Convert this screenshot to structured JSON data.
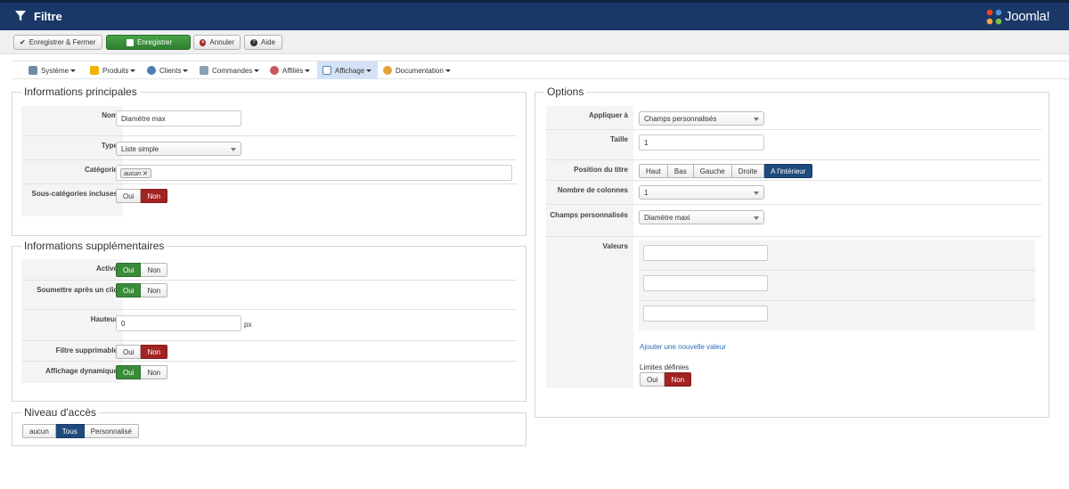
{
  "header": {
    "title": "Filtre",
    "logo_text": "Joomla!"
  },
  "toolbar": {
    "save_close": "Enregistrer & Fermer",
    "save": "Enregistrer",
    "cancel": "Annuler",
    "help": "Aide"
  },
  "menu": {
    "items": [
      {
        "label": "Système",
        "icon": "tools-icon"
      },
      {
        "label": "Produits",
        "icon": "box-icon"
      },
      {
        "label": "Clients",
        "icon": "users-icon"
      },
      {
        "label": "Commandes",
        "icon": "cart-icon"
      },
      {
        "label": "Affiliés",
        "icon": "affiliates-icon"
      },
      {
        "label": "Affichage",
        "icon": "display-icon"
      },
      {
        "label": "Documentation",
        "icon": "docs-icon"
      }
    ],
    "active": "Affichage"
  },
  "main_info": {
    "legend": "Informations principales",
    "name_label": "Nom",
    "name_value": "Diamètre max",
    "type_label": "Type",
    "type_value": "Liste simple",
    "category_label": "Catégorie",
    "category_tag": "aucun",
    "subcat_label": "Sous-catégories incluses",
    "yes": "Oui",
    "no": "Non"
  },
  "extra_info": {
    "legend": "Informations supplémentaires",
    "active_label": "Activé",
    "submit_label": "Soumettre après un clic",
    "height_label": "Hauteur",
    "height_value": "0",
    "height_unit": "px",
    "deletable_label": "Filtre supprimable",
    "dynamic_label": "Affichage dynamique",
    "yes": "Oui",
    "no": "Non"
  },
  "access": {
    "legend": "Niveau d'accès",
    "options": [
      "aucun",
      "Tous",
      "Personnalisé"
    ],
    "selected": "Tous"
  },
  "options": {
    "legend": "Options",
    "apply_label": "Appliquer à",
    "apply_value": "Champs personnalisés",
    "size_label": "Taille",
    "size_value": "1",
    "title_pos_label": "Position du titre",
    "title_pos_options": [
      "Haut",
      "Bas",
      "Gauche",
      "Droite",
      "A l'intérieur"
    ],
    "title_pos_selected": "A l'intérieur",
    "columns_label": "Nombre de colonnes",
    "columns_value": "1",
    "custom_fields_label": "Champs personnalisés",
    "custom_fields_value": "Diamètre maxi",
    "values_label": "Valeurs",
    "add_value_link": "Ajouter une nouvelle valeur",
    "limits_label": "Limites définies",
    "yes": "Oui",
    "no": "Non"
  },
  "colors": {
    "header_bg": "#1a3867",
    "success": "#3a8b3a",
    "danger": "#a32222",
    "primary": "#1f4a7c"
  }
}
